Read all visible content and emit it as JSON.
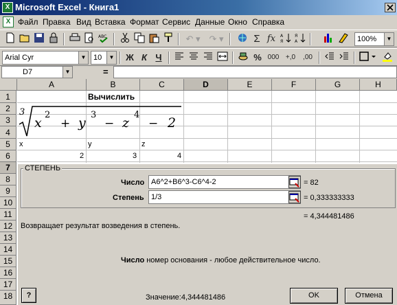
{
  "window": {
    "title": "Microsoft Excel - Книга1"
  },
  "menu": [
    "Файл",
    "Правка",
    "Вид",
    "Вставка",
    "Формат",
    "Сервис",
    "Данные",
    "Окно",
    "Справка"
  ],
  "toolbar": {
    "zoom": "100%",
    "fx_label": "fx"
  },
  "format_bar": {
    "font": "Arial Cyr",
    "size": "10",
    "bold": "Ж",
    "italic": "К",
    "underline": "Ч",
    "percent": "%",
    "thousands": "000",
    "inc_dec": "+,0",
    "dec_dec": ",00"
  },
  "name_box": "D7",
  "formula_eq": "=",
  "columns": [
    "A",
    "B",
    "C",
    "D",
    "E",
    "F",
    "G",
    "H"
  ],
  "rows": [
    "1",
    "2",
    "3",
    "4",
    "5",
    "6",
    "7",
    "8",
    "9",
    "10",
    "11",
    "12",
    "13",
    "14",
    "15",
    "16",
    "17",
    "18"
  ],
  "cells": {
    "b1": "Вычислить",
    "a5": "x",
    "b5": "y",
    "c5": "z",
    "a6": "2",
    "b6": "3",
    "c6": "4"
  },
  "formula_image": {
    "root_index": "3",
    "expr": "x² + y³ − z⁴ − 2"
  },
  "dialog": {
    "group_title": "СТЕПЕНЬ",
    "arg1_label": "Число",
    "arg1_value": "A6^2+B6^3-C6^4-2",
    "arg1_result": "= 82",
    "arg2_label": "Степень",
    "arg2_value": "1/3",
    "arg2_result": "= 0,333333333",
    "total_result": "= 4,344481486",
    "description": "Возвращает результат возведения в степень.",
    "hint_bold": "Число",
    "hint_text": " номер основания - любое действительное число.",
    "value_label": "Значение:4,344481486",
    "help_label": "?",
    "ok_label": "OK",
    "cancel_label": "Отмена"
  }
}
